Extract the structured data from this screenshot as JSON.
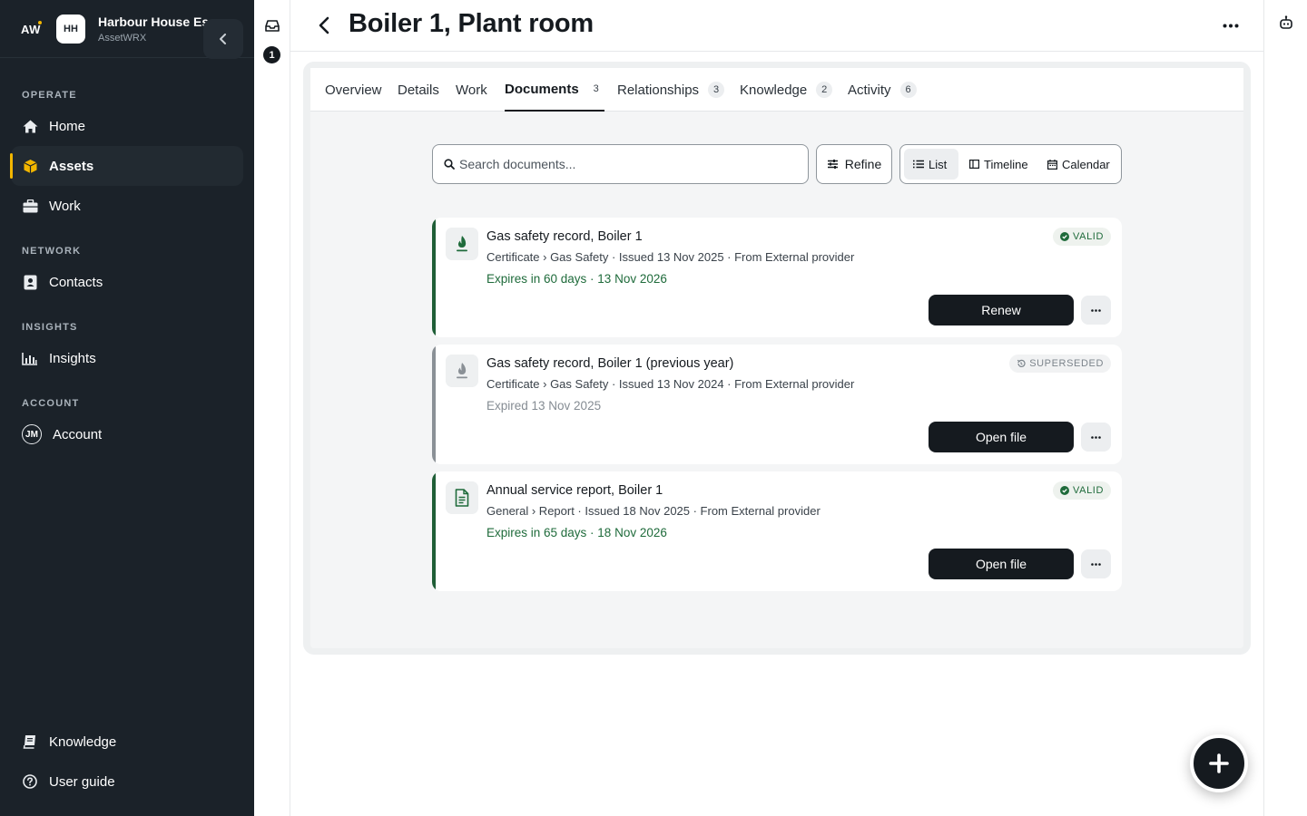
{
  "org": {
    "logo_text": "AW",
    "avatar_initials": "HH",
    "name": "Harbour House Es...",
    "subtitle": "AssetWRX"
  },
  "sidebar": {
    "sections": {
      "operate": "OPERATE",
      "network": "NETWORK",
      "insights": "INSIGHTS",
      "account": "ACCOUNT"
    },
    "items": {
      "home": "Home",
      "assets": "Assets",
      "work": "Work",
      "contacts": "Contacts",
      "insights": "Insights",
      "account": "Account",
      "knowledge": "Knowledge",
      "user_guide": "User guide"
    },
    "account_initials": "JM",
    "active_item": "Assets",
    "accent_color": "#f2b600"
  },
  "rail": {
    "notification_count": "1"
  },
  "header": {
    "title": "Boiler 1, Plant room"
  },
  "tabs": [
    {
      "label": "Overview",
      "count": null
    },
    {
      "label": "Details",
      "count": null
    },
    {
      "label": "Work",
      "count": null
    },
    {
      "label": "Documents",
      "count": "3"
    },
    {
      "label": "Relationships",
      "count": "3"
    },
    {
      "label": "Knowledge",
      "count": "2"
    },
    {
      "label": "Activity",
      "count": "6"
    }
  ],
  "active_tab": "Documents",
  "toolbar": {
    "search_placeholder": "Search documents...",
    "refine_label": "Refine",
    "views": {
      "list": "List",
      "timeline": "Timeline",
      "calendar": "Calendar"
    },
    "active_view": "List"
  },
  "documents": [
    {
      "title": "Gas safety record, Boiler 1",
      "meta": "Certificate › Gas Safety · Issued 13 Nov 2025 · From External provider",
      "expiry": "Expires in 60 days · 13 Nov 2026",
      "status": "VALID",
      "action": "Renew",
      "icon": "flame-icon"
    },
    {
      "title": "Gas safety record, Boiler 1 (previous year)",
      "meta": "Certificate › Gas Safety · Issued 13 Nov 2024 · From External provider",
      "expiry": "Expired 13 Nov 2025",
      "status": "SUPERSEDED",
      "action": "Open file",
      "icon": "flame-icon"
    },
    {
      "title": "Annual service report, Boiler 1",
      "meta": "General › Report · Issued 18 Nov 2025 · From External provider",
      "expiry": "Expires in 65 days · 18 Nov 2026",
      "status": "VALID",
      "action": "Open file",
      "icon": "document-icon"
    }
  ],
  "colors": {
    "valid": "#1f6b3b",
    "superseded": "#8a9096",
    "sidebar_bg": "#1b2229",
    "primary": "#151a1f"
  }
}
